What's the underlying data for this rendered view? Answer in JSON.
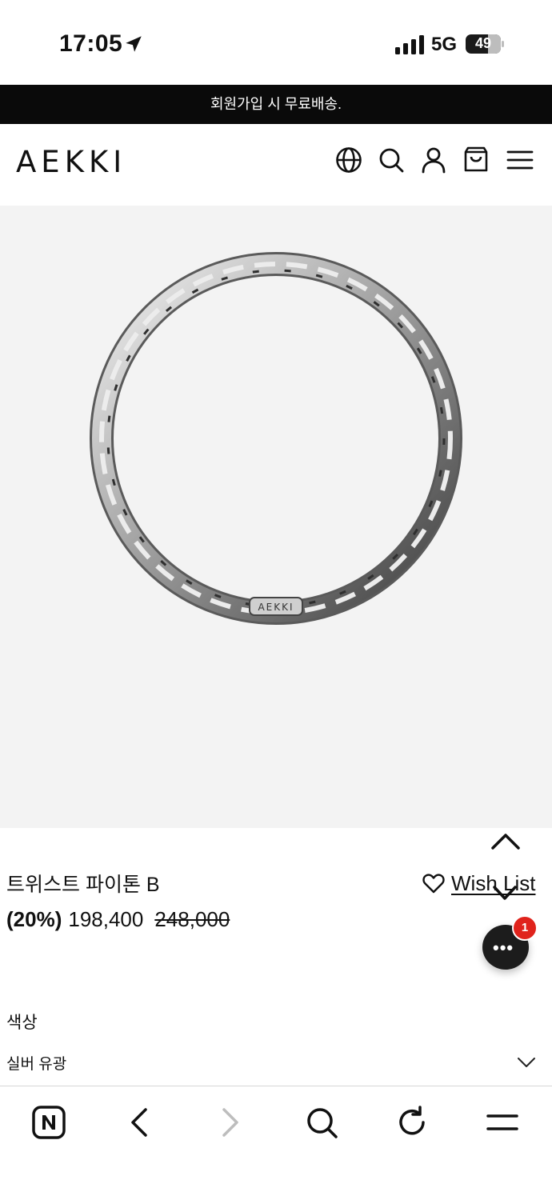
{
  "status_bar": {
    "time": "17:05",
    "network": "5G",
    "battery": "49"
  },
  "banner": {
    "text": "회원가입 시 무료배송."
  },
  "header": {
    "logo": "AEKKI",
    "icons": [
      "globe-icon",
      "search-icon",
      "user-icon",
      "cart-icon",
      "menu-icon"
    ]
  },
  "product": {
    "name": "트위스트 파이톤 B",
    "discount": "(20%)",
    "sale_price": "198,400",
    "original_price": "248,000",
    "wish_label": "Wish List",
    "image_alt": "silver twisted python chain bracelet"
  },
  "chat": {
    "badge": "1"
  },
  "options": {
    "color_label": "색상",
    "color_value": "실버 유광"
  },
  "browser_toolbar": {
    "icons": [
      "naver-home-icon",
      "back-icon",
      "forward-icon",
      "search-icon",
      "reload-icon",
      "menu-icon"
    ]
  }
}
